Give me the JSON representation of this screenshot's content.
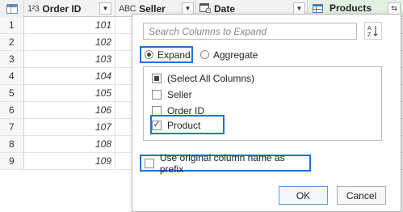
{
  "columns": {
    "order_id": {
      "type_icon": "1²3",
      "title": "Order ID"
    },
    "seller": {
      "type_icon": "ABC",
      "title": "Seller"
    },
    "date": {
      "type_icon": "calendar-icon",
      "title": "Date"
    },
    "products": {
      "type_icon": "table-icon",
      "title": "Products"
    }
  },
  "rows": [
    {
      "num": "1",
      "order_id": "101"
    },
    {
      "num": "2",
      "order_id": "102"
    },
    {
      "num": "3",
      "order_id": "103"
    },
    {
      "num": "4",
      "order_id": "104"
    },
    {
      "num": "5",
      "order_id": "105"
    },
    {
      "num": "6",
      "order_id": "106"
    },
    {
      "num": "7",
      "order_id": "107"
    },
    {
      "num": "8",
      "order_id": "108"
    },
    {
      "num": "9",
      "order_id": "109"
    }
  ],
  "popup": {
    "search_placeholder": "Search Columns to Expand",
    "sort_icon": "sort-az-icon",
    "mode": {
      "expand_label": "Expand",
      "aggregate_label": "Aggregate",
      "selected": "Expand"
    },
    "columns_list": [
      {
        "label": "(Select All Columns)",
        "state": "partial"
      },
      {
        "label": "Seller",
        "state": "unchecked"
      },
      {
        "label": "Order ID",
        "state": "unchecked"
      },
      {
        "label": "Product",
        "state": "checked"
      }
    ],
    "prefix_label": "Use original column name as prefix",
    "prefix_checked": false,
    "ok_label": "OK",
    "cancel_label": "Cancel"
  },
  "colors": {
    "highlight": "#1a73d8",
    "products_header_bg": "#e3f1e3"
  }
}
